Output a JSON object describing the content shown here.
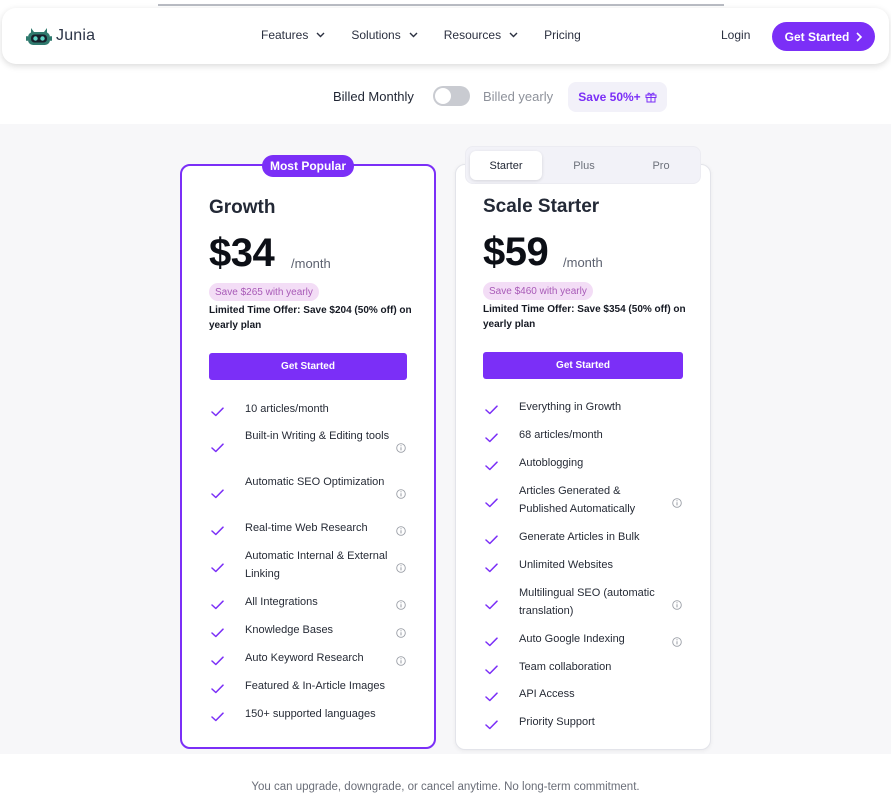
{
  "brand": {
    "name": "Junia",
    "accent": "#7b2ff7"
  },
  "nav": {
    "items": [
      "Features",
      "Solutions",
      "Resources",
      "Pricing"
    ],
    "login": "Login",
    "cta": "Get Started"
  },
  "billing": {
    "monthly_label": "Billed Monthly",
    "yearly_label": "Billed yearly",
    "save_badge": "Save 50%+",
    "yearly_enabled": false
  },
  "growth": {
    "badge": "Most Popular",
    "name": "Growth",
    "price": "$34",
    "per": "/month",
    "save_pill": "Save $265 with yearly",
    "offer": "Limited Time Offer: Save $204 (50% off) on yearly plan",
    "button": "Get Started",
    "features": [
      {
        "text": "10 articles/month",
        "info": false
      },
      {
        "text": "Built-in Writing & Editing tools",
        "info": true
      },
      {
        "text": "Automatic SEO Optimization",
        "info": true
      },
      {
        "text": "Real-time Web Research",
        "info": true
      },
      {
        "text": "Automatic Internal & External Linking",
        "info": true
      },
      {
        "text": "All Integrations",
        "info": true
      },
      {
        "text": "Knowledge Bases",
        "info": true
      },
      {
        "text": "Auto Keyword Research",
        "info": true
      },
      {
        "text": "Featured & In-Article Images",
        "info": false
      },
      {
        "text": "150+ supported languages",
        "info": false
      }
    ]
  },
  "scale": {
    "tabs": [
      "Starter",
      "Plus",
      "Pro"
    ],
    "active_tab": "Starter",
    "name": "Scale Starter",
    "price": "$59",
    "per": "/month",
    "save_pill": "Save $460 with yearly",
    "offer": "Limited Time Offer: Save $354 (50% off) on yearly plan",
    "button": "Get Started",
    "features": [
      {
        "text": "Everything in Growth",
        "info": false
      },
      {
        "text": "68 articles/month",
        "info": false
      },
      {
        "text": "Autoblogging",
        "info": false
      },
      {
        "text": "Articles Generated & Published Automatically",
        "info": true
      },
      {
        "text": "Generate Articles in Bulk",
        "info": false
      },
      {
        "text": "Unlimited Websites",
        "info": false
      },
      {
        "text": "Multilingual SEO (automatic translation)",
        "info": true
      },
      {
        "text": "Auto Google Indexing",
        "info": true
      },
      {
        "text": "Team collaboration",
        "info": false
      },
      {
        "text": "API Access",
        "info": false
      },
      {
        "text": "Priority Support",
        "info": false
      }
    ]
  },
  "footer_note": "You can upgrade, downgrade, or cancel anytime. No long-term commitment."
}
